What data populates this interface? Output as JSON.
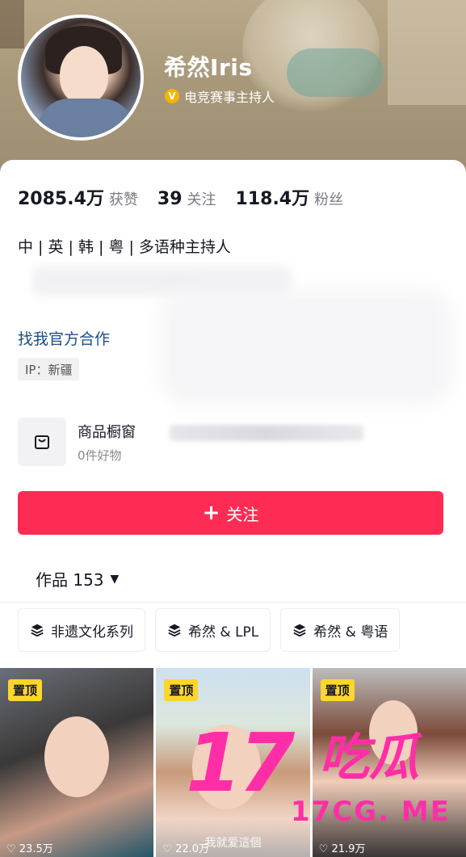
{
  "profile": {
    "name": "希然Iris",
    "verify_icon": "V",
    "verify_text": "电竞赛事主持人"
  },
  "stats": [
    {
      "num": "2085.4万",
      "label": "获赞"
    },
    {
      "num": "39",
      "label": "关注"
    },
    {
      "num": "118.4万",
      "label": "粉丝"
    }
  ],
  "bio": "中 | 英 | 韩 | 粤 | 多语种主持人",
  "cooperate": "找我官方合作",
  "ip": "IP：新疆",
  "shop": {
    "title": "商品橱窗",
    "subtitle": "0件好物"
  },
  "follow_button": {
    "plus": "+",
    "label": "关注"
  },
  "works": {
    "label": "作品 153",
    "arrow": "▼"
  },
  "collections": [
    {
      "label": "非遗文化系列"
    },
    {
      "label": "希然 & LPL"
    },
    {
      "label": "希然 & 粤语"
    }
  ],
  "videos": [
    {
      "pin": "置顶",
      "likes": "♡ 23.5万",
      "caption": ""
    },
    {
      "pin": "置顶",
      "likes": "♡ 22.0万",
      "caption": "我就爱這個"
    },
    {
      "pin": "置顶",
      "likes": "♡ 21.9万",
      "caption": ""
    }
  ],
  "watermark": {
    "big": "17",
    "cn": "吃瓜",
    "domain": "17CG. ME"
  },
  "colors": {
    "accent": "#fe2c55",
    "link": "#1d4c88",
    "pin": "#fdd62b",
    "verify": "#f5b400",
    "watermark": "#ff2ea6"
  }
}
